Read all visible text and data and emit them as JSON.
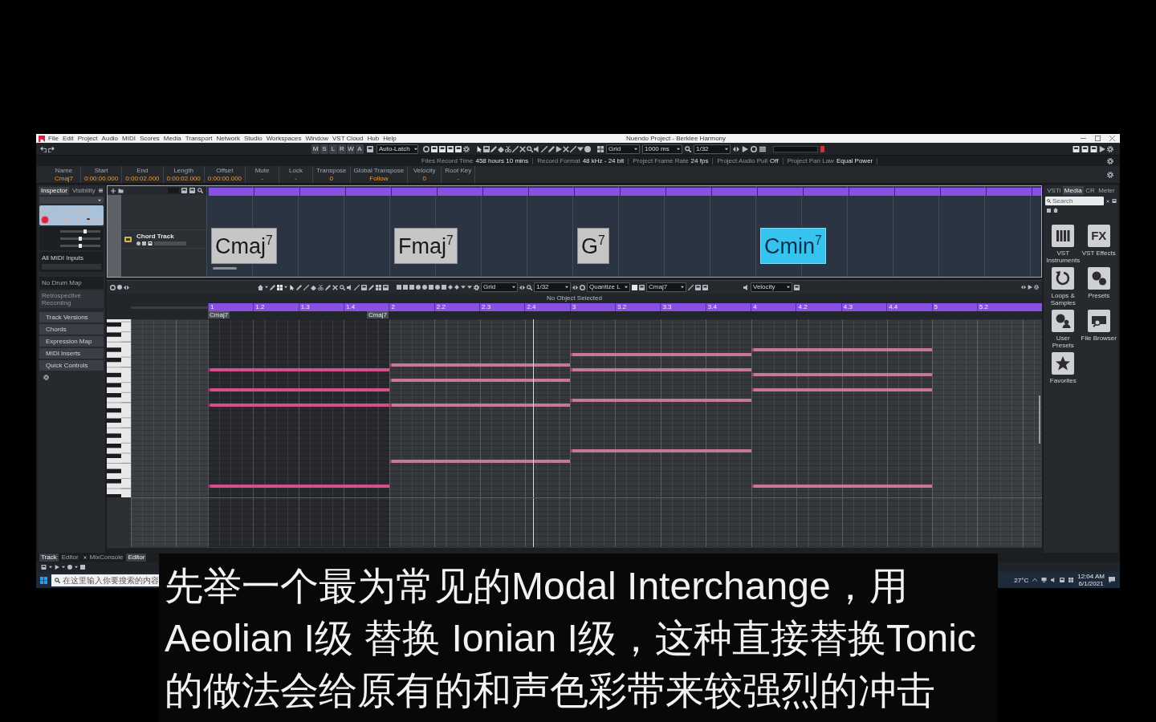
{
  "window": {
    "title": "Nuendo Project - Berklee Harmony"
  },
  "menu": [
    "File",
    "Edit",
    "Project",
    "Audio",
    "MIDI",
    "Scores",
    "Media",
    "Transport",
    "Network",
    "Studio",
    "Workspaces",
    "Window",
    "VST Cloud",
    "Hub",
    "Help"
  ],
  "toolbar": {
    "state_buttons": [
      "M",
      "S",
      "L",
      "R",
      "W",
      "A"
    ],
    "automation_mode": "Auto-Latch",
    "snap_type": "Grid",
    "cursor_time": "1000 ms",
    "quantize": "1/32"
  },
  "status_line": [
    {
      "label": "Files Record Time",
      "value": "458 hours 10 mins"
    },
    {
      "label": "Record Format",
      "value": "48 kHz - 24 bit"
    },
    {
      "label": "Project Frame Rate",
      "value": "24 fps"
    },
    {
      "label": "Project Audio Pull",
      "value": "Off"
    },
    {
      "label": "Project Pan Law",
      "value": "Equal Power"
    }
  ],
  "info_line": [
    {
      "label": "Name",
      "value": "Cmaj7"
    },
    {
      "label": "Start",
      "value": "0:00:00.000"
    },
    {
      "label": "End",
      "value": "0:00:02.000"
    },
    {
      "label": "Length",
      "value": "0:00:02.000"
    },
    {
      "label": "Offset",
      "value": "0:00:00.000"
    },
    {
      "label": "Mute",
      "value": "-"
    },
    {
      "label": "Lock",
      "value": "-"
    },
    {
      "label": "Transpose",
      "value": "0"
    },
    {
      "label": "Global Transpose",
      "value": "Follow"
    },
    {
      "label": "Velocity",
      "value": "0"
    },
    {
      "label": "Root Key",
      "value": "-"
    }
  ],
  "inspector": {
    "tabs": [
      {
        "label": "Inspector",
        "selected": true
      },
      {
        "label": "Visibility",
        "selected": false
      }
    ],
    "sliders": [
      {
        "level": 0.62
      },
      {
        "level": 0.5
      },
      {
        "level": 0.5
      }
    ],
    "midi_input": "All MIDI Inputs",
    "drum_map": "No Drum Map",
    "retrospective": "Retrospective Recording",
    "sections": [
      "Track Versions",
      "Chords",
      "Expression Map",
      "MIDI Inserts",
      "Quick Controls"
    ]
  },
  "chord_track": {
    "name": "Chord Track",
    "chords": [
      {
        "symbol": "Cmaj$^{7}$",
        "selected": false
      },
      {
        "symbol": "Fmaj$^{7}$",
        "selected": false
      },
      {
        "symbol": "G$^{7}$",
        "selected": false
      },
      {
        "symbol": "Cmin$^{7}$",
        "selected": true
      }
    ]
  },
  "key_editor": {
    "toolbar": {
      "snap_type": "Grid",
      "quantize": "1/32",
      "quantize_preset": "Quantize L",
      "chord": "Cmaj7",
      "controller": "Velocity"
    },
    "status": "No Object Selected",
    "ruler": [
      "1",
      "1.2",
      "1.3",
      "1.4",
      "2",
      "2.2",
      "2.3",
      "2.4",
      "3",
      "3.2",
      "3.3",
      "3.4",
      "4",
      "4.2",
      "4.3",
      "4.4",
      "5",
      "5.2"
    ],
    "chord_events": [
      "Cmaj7",
      "Cmaj7"
    ]
  },
  "right_zone": {
    "tabs": [
      {
        "label": "VSTi",
        "selected": false
      },
      {
        "label": "Media",
        "selected": true
      },
      {
        "label": "CR",
        "selected": false
      },
      {
        "label": "Meter",
        "selected": false
      }
    ],
    "search": {
      "placeholder": "Search"
    },
    "tile_rows": [
      [
        {
          "kind": "instruments",
          "label": "VST Instruments"
        },
        {
          "kind": "effects",
          "glyph": "FX",
          "label": "VST Effects"
        }
      ],
      [
        {
          "kind": "loops",
          "label": "Loops & Samples"
        },
        {
          "kind": "presets",
          "label": "Presets"
        }
      ],
      [
        {
          "kind": "user_presets",
          "label": "User Presets"
        },
        {
          "kind": "file_browser",
          "label": "File Browser"
        }
      ],
      [
        {
          "kind": "favorites",
          "label": "Favorites"
        }
      ]
    ]
  },
  "bottom_tabs": [
    {
      "label": "Track",
      "selected": true
    },
    {
      "label": "Editor",
      "selected": false
    },
    {
      "label": "MixConsole",
      "selected": false
    },
    {
      "label": "Editor",
      "selected": true
    }
  ],
  "taskbar": {
    "search": {
      "placeholder": "在这里输入你要搜索的内容"
    },
    "weather": "27°C",
    "time": "12:04 AM",
    "date": "6/1/2021"
  },
  "subtitle": {
    "lines": [
      "先举一个最为常见的Modal Interchange，用",
      "Aeolian I级 替换 Ionian I级，这种直接替换Tonic",
      "的做法会给原有的和声色彩带来较强烈的冲击"
    ]
  }
}
